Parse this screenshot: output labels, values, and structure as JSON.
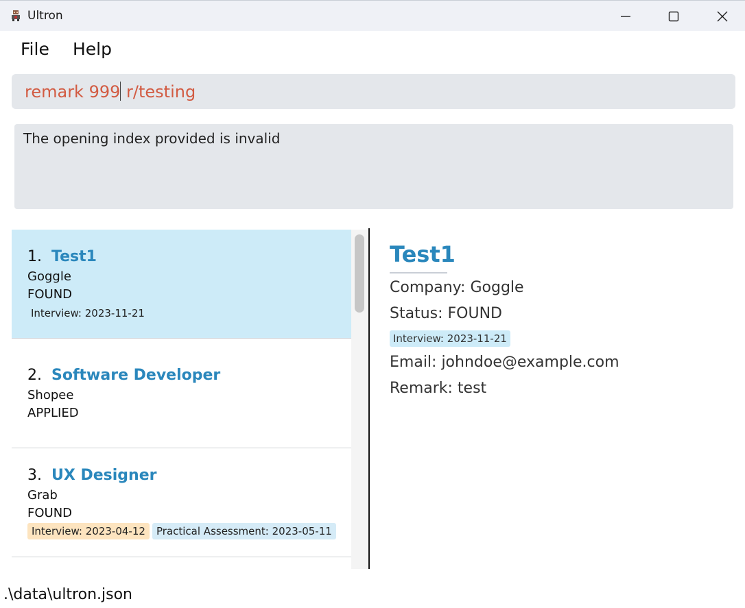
{
  "window": {
    "title": "Ultron"
  },
  "menu": {
    "file": "File",
    "help": "Help"
  },
  "command": {
    "before_caret": "remark 999",
    "after_caret": " r/testing"
  },
  "result": {
    "message": "The opening index provided is invalid"
  },
  "list": {
    "items": [
      {
        "index": "1.",
        "title": "Test1",
        "company": "Goggle",
        "status": "FOUND",
        "tag": "Interview: 2023-11-21"
      },
      {
        "index": "2.",
        "title": "Software Developer",
        "company": "Shopee",
        "status": "APPLIED"
      },
      {
        "index": "3.",
        "title": "UX Designer",
        "company": "Grab",
        "status": "FOUND",
        "tags": [
          "Interview: 2023-04-12",
          "Practical Assessment: 2023-05-11"
        ]
      }
    ]
  },
  "detail": {
    "title": "Test1",
    "company": "Company: Goggle",
    "status": "Status: FOUND",
    "tag": "Interview: 2023-11-21",
    "email": "Email: johndoe@example.com",
    "remark": "Remark: test"
  },
  "statusbar": {
    "path": ".\\data\\ultron.json"
  },
  "colors": {
    "accent": "#2a87bc",
    "command_text": "#d25b42",
    "selected_card": "#cdebf8",
    "interview_tag_today": "#cdebf8",
    "interview_tag_past": "#fde4bf",
    "assessment_tag": "#d5ebf7"
  },
  "icons": [
    "app-robot-icon",
    "minimize-icon",
    "maximize-icon",
    "close-icon"
  ]
}
